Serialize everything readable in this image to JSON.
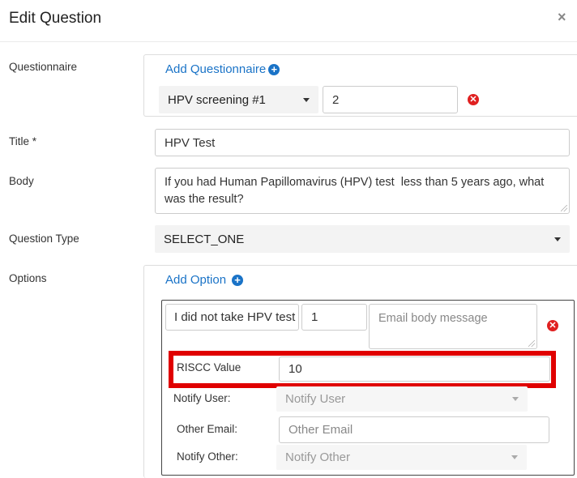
{
  "dialog": {
    "title": "Edit Question",
    "close_glyph": "×"
  },
  "questionnaire": {
    "label": "Questionnaire",
    "add_label": "Add Questionnaire",
    "selected": "HPV screening #1",
    "order_value": "2"
  },
  "title_field": {
    "label": "Title *",
    "value": "HPV Test"
  },
  "body_field": {
    "label": "Body",
    "value": "If you had Human Papillomavirus (HPV) test  less than 5 years ago, what was the result?"
  },
  "question_type": {
    "label": "Question Type",
    "selected": "SELECT_ONE"
  },
  "options": {
    "label": "Options",
    "add_label": "Add Option",
    "items": [
      {
        "text": "I did not take HPV test",
        "order": "1",
        "email_body_placeholder": "Email body message",
        "riscc_label": "RISCC Value",
        "riscc_value": "10",
        "notify_user_label": "Notify User:",
        "notify_user_placeholder": "Notify User",
        "other_email_label": "Other Email:",
        "other_email_placeholder": "Other Email",
        "notify_other_label": "Notify Other:",
        "notify_other_placeholder": "Notify Other"
      }
    ]
  },
  "colors": {
    "accent": "#1a73c7",
    "remove": "#e02020",
    "highlight": "#e00000"
  },
  "icons": [
    "close-icon",
    "plus-circle-icon",
    "caret-down-icon",
    "remove-circle-icon"
  ]
}
